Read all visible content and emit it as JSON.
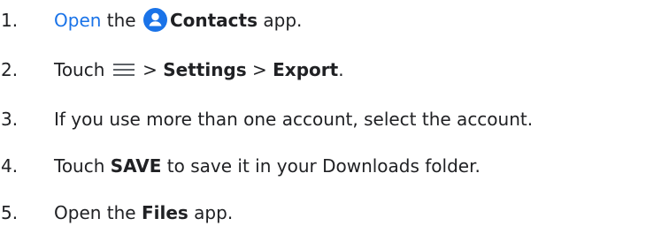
{
  "steps": [
    {
      "number": "1.",
      "parts": {
        "link": "Open",
        "text1": " the ",
        "icon": "contacts-app-icon",
        "bold1": "Contacts",
        "text2": " app."
      }
    },
    {
      "number": "2.",
      "parts": {
        "text1": "Touch ",
        "icon": "menu-icon",
        "text2": " > ",
        "bold1": "Settings",
        "text3": " > ",
        "bold2": "Export",
        "text4": "."
      }
    },
    {
      "number": "3.",
      "parts": {
        "text1": "If you use more than one account, select the account."
      }
    },
    {
      "number": "4.",
      "parts": {
        "text1": "Touch ",
        "bold1": "SAVE",
        "text2": " to save it in your Downloads folder."
      }
    },
    {
      "number": "5.",
      "parts": {
        "text1": "Open the ",
        "bold1": "Files",
        "text2": " app."
      }
    }
  ],
  "colors": {
    "text": "#202124",
    "link": "#1a73e8",
    "icon_bg": "#1a73e8",
    "menu_icon": "#5f6368"
  }
}
